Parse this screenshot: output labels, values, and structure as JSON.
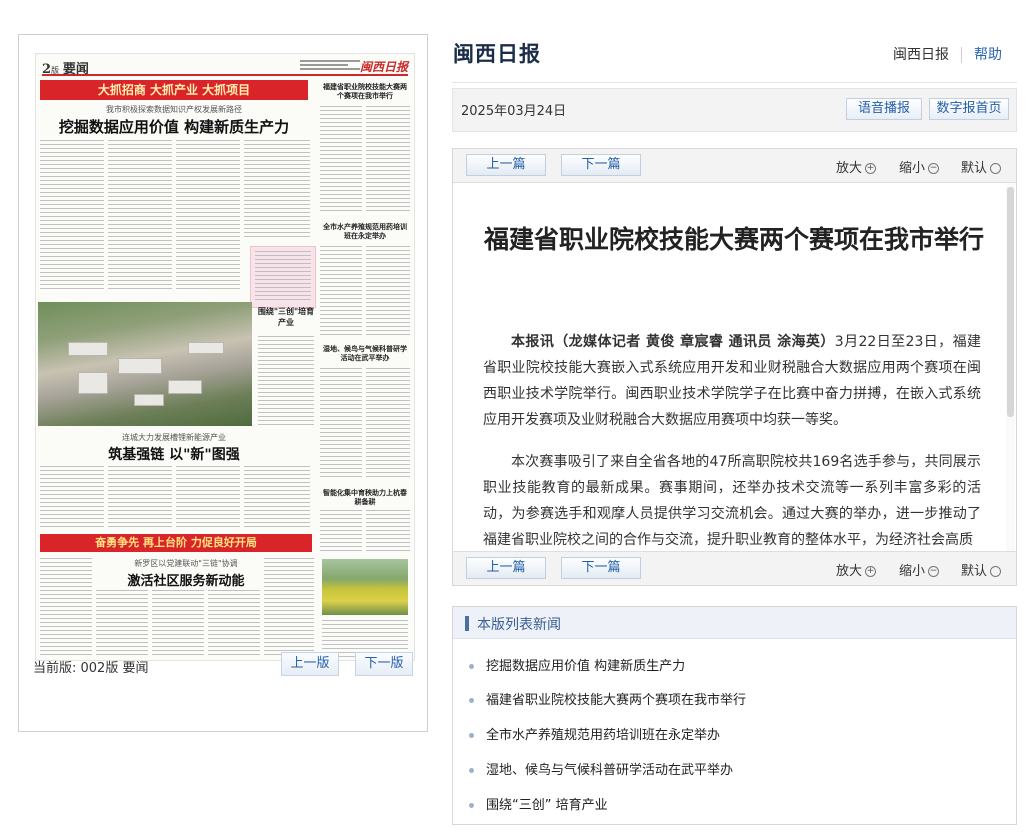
{
  "newspaper_page": {
    "page_no": "2",
    "page_unit": "版",
    "section": "要闻",
    "masthead": "闽西日报",
    "banner_top": "大抓招商  大抓产业  大抓项目",
    "lead_subtitle": "我市积极探索数据知识产权发展新路径",
    "lead_title": "挖掘数据应用价值  构建新质生产力",
    "side_head_1": "福建省职业院校技能大赛两个赛项在我市举行",
    "side_head_2": "全市水产养殖规范用药培训班在永定举办",
    "side_head_3": "湿地、候鸟与气候科普研学活动在武平举办",
    "side_head_4": "智能化集中育秧助力上杭春耕备耕",
    "photo_caption_title": "围绕\"三创\"培育产业",
    "mid_subtitle": "连城大力发展槽锂新能源产业",
    "mid_title": "筑基强链  以\"新\"图强",
    "banner_bottom": "奋勇争先  再上台阶  力促良好开局",
    "lower_subtitle": "新罗区以党建联动\"三链\"协调",
    "lower_title": "激活社区服务新动能"
  },
  "left_footer": {
    "current_label": "当前版: 002版 要闻",
    "prev_page": "上一版",
    "next_page": "下一版"
  },
  "header": {
    "site_title": "闽西日报",
    "nav_home": "闽西日报",
    "nav_help": "帮助"
  },
  "date_bar": {
    "date": "2025年03月24日",
    "voice_button": "语音播报",
    "digital_home_button": "数字报首页"
  },
  "toolbar": {
    "prev_article": "上一篇",
    "next_article": "下一篇",
    "zoom_in": "放大",
    "zoom_out": "缩小",
    "default": "默认"
  },
  "article": {
    "title": "福建省职业院校技能大赛两个赛项在我市举行",
    "byline": "本报讯（龙媒体记者 黄俊 章宸睿 通讯员 涂海英）",
    "para1": "3月22日至23日，福建省职业院校技能大赛嵌入式系统应用开发和业财税融合大数据应用两个赛项在闽西职业技术学院举行。闽西职业技术学院学子在比赛中奋力拼搏，在嵌入式系统应用开发赛项及业财税融合大数据应用赛项中均获一等奖。",
    "para2": "本次赛事吸引了来自全省各地的47所高职院校共169名选手参与，共同展示职业技能教育的最新成果。赛事期间，还举办技术交流等一系列丰富多彩的活动，为参赛选手和观摩人员提供学习交流机会。通过大赛的举办，进一步推动了福建省职业院校之间的合作与交流，提升职业教育的整体水平，为经济社会高质"
  },
  "news_list": {
    "heading": "本版列表新闻",
    "items": [
      "挖掘数据应用价值 构建新质生产力",
      "福建省职业院校技能大赛两个赛项在我市举行",
      "全市水产养殖规范用药培训班在永定举办",
      "湿地、候鸟与气候科普研学活动在武平举办",
      "围绕“三创” 培育产业"
    ]
  },
  "colors": {
    "accent_red": "#d9242a",
    "link_blue": "#245fa8",
    "title_navy": "#1b2d48"
  }
}
